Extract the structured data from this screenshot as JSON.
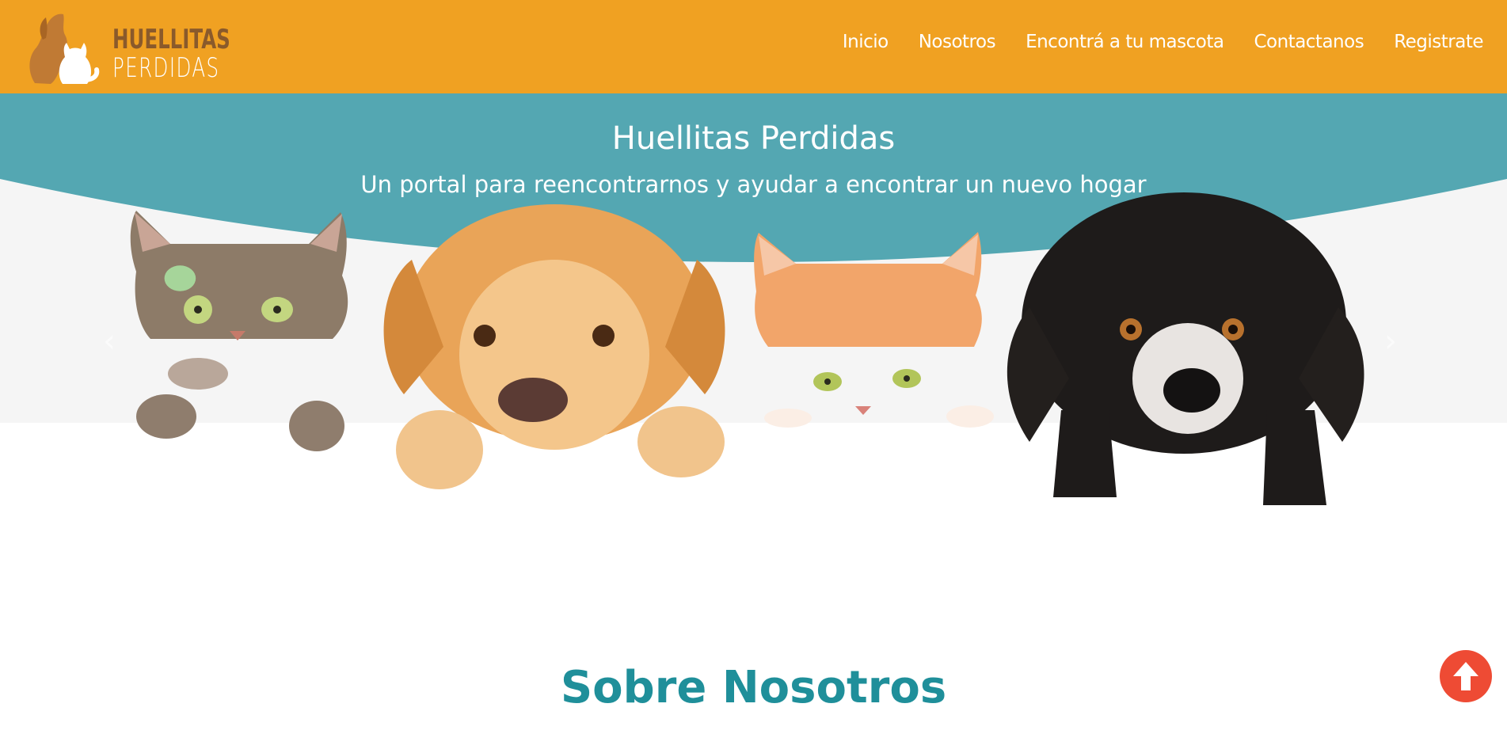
{
  "brand": {
    "line1": "HUELLITAS",
    "line2": "PERDIDAS"
  },
  "nav": [
    {
      "label": "Inicio"
    },
    {
      "label": "Nosotros"
    },
    {
      "label": "Encontrá a tu mascota"
    },
    {
      "label": "Contactanos"
    },
    {
      "label": "Registrate"
    }
  ],
  "hero": {
    "title": "Huellitas Perdidas",
    "subtitle": "Un portal para reencontrarnos y ayudar a encontrar un nuevo hogar"
  },
  "about": {
    "title": "Sobre Nosotros"
  },
  "icons": {
    "scroll_top": "arrow-up-icon",
    "prev": "chevron-left-icon",
    "next": "chevron-right-icon"
  },
  "colors": {
    "navbar": "#f0a122",
    "hero_band": "#54a7b2",
    "about_title": "#1f8f9a",
    "scroll_top": "#ee4b34"
  }
}
